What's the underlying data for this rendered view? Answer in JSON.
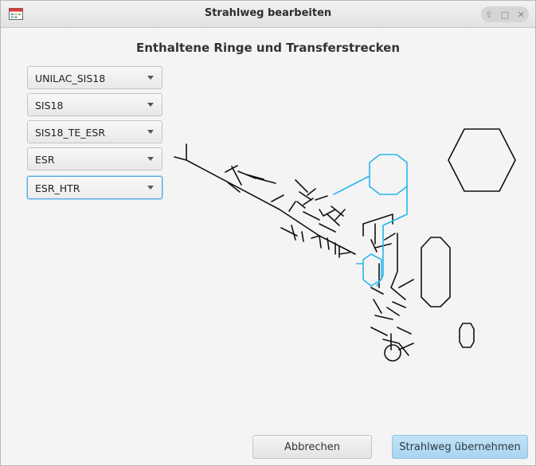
{
  "window": {
    "title": "Strahlweg bearbeiten",
    "controls": [
      "up-arrow-icon",
      "maximize-icon",
      "close-icon"
    ]
  },
  "heading": "Enthaltene Ringe und Transferstrecken",
  "dropdowns": [
    {
      "value": "UNILAC_SIS18"
    },
    {
      "value": "SIS18"
    },
    {
      "value": "SIS18_TE_ESR"
    },
    {
      "value": "ESR"
    },
    {
      "value": "ESR_HTR",
      "focused": true
    }
  ],
  "map": {
    "line_color": "#111111",
    "highlight_color": "#29b6ea"
  },
  "buttons": {
    "cancel": "Abbrechen",
    "apply": "Strahlweg übernehmen"
  },
  "colors": {
    "accent": "#a9d5f0",
    "focus": "#55aadd"
  }
}
